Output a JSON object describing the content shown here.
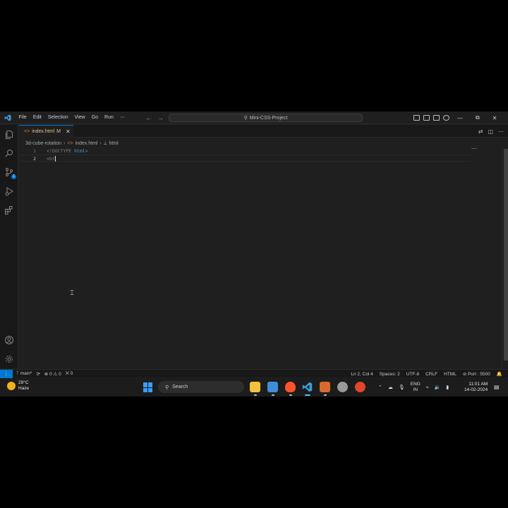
{
  "titlebar": {
    "menu": [
      "File",
      "Edit",
      "Selection",
      "View",
      "Go",
      "Run",
      "⋯"
    ],
    "command_center": "Mini-CSS-Project",
    "window_controls": [
      "—",
      "⧉",
      "✕"
    ]
  },
  "tab": {
    "name": "index.html",
    "modified": "M",
    "close": "✕"
  },
  "breadcrumb": {
    "folder": "3d-cube-rotation",
    "file": "index.html",
    "symbol": "html"
  },
  "editor": {
    "lines": [
      {
        "number": "1",
        "prefix": "<!DOCTYPE",
        "rest": " html>"
      },
      {
        "number": "2",
        "prefix": "<ht",
        "rest": ""
      }
    ]
  },
  "activity": {
    "scm_badge": "1"
  },
  "statusbar": {
    "branch": "main*",
    "errors": "0",
    "warnings": "0",
    "ports": "0",
    "position": "Ln 2, Col 4",
    "spaces": "Spaces: 2",
    "encoding": "UTF-8",
    "eol": "CRLF",
    "language": "HTML",
    "port": "Port : 5500"
  },
  "taskbar": {
    "temp": "29°C",
    "condition": "Haze",
    "search_placeholder": "Search",
    "lang_top": "ENG",
    "lang_bottom": "IN",
    "time": "11:01 AM",
    "date": "14-02-2024"
  },
  "colors": {
    "accent": "#0078d4",
    "editor_bg": "#1f1f1f",
    "modified": "#e2c08d"
  }
}
